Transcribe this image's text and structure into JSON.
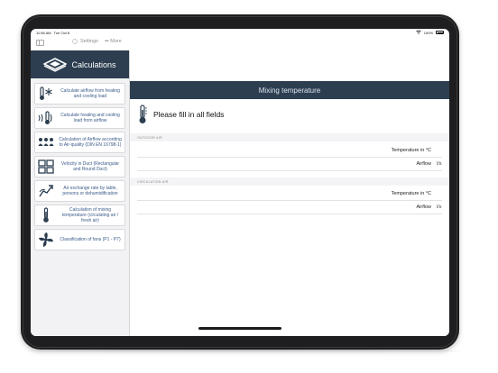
{
  "status_bar": {
    "time": "11:56 AM",
    "date": "Tue Oct 8",
    "battery": "100%"
  },
  "topbar": {
    "settings_label": "Settings",
    "more_label": "More"
  },
  "sidebar": {
    "title": "Calculations",
    "items": [
      {
        "label": "Calculate airflow from heating and cooling load",
        "icon": "thermometer-snowflake-icon"
      },
      {
        "label": "Calculate heating and cooling load from airflow",
        "icon": "airflow-thermometer-icon"
      },
      {
        "label": "Calculation of Airflow according to Air-quality (DIN EN 16798-1)",
        "icon": "people-group-icon"
      },
      {
        "label": "Velocity in Duct (Rectangular and Round Duct)",
        "icon": "duct-grid-icon"
      },
      {
        "label": "Air exchange rate by table, persons or dehumidification",
        "icon": "air-exchange-icon"
      },
      {
        "label": "Calculation of mixing temperature (circulating air / fresh air)",
        "icon": "mixing-thermometer-icon"
      },
      {
        "label": "Classification of fans (P1 - P7)",
        "icon": "fan-icon"
      }
    ]
  },
  "main": {
    "title": "Mixing temperature",
    "instruction": "Please fill in all fields",
    "sections": [
      {
        "label": "OUTDOOR AIR",
        "fields": [
          {
            "label": "Temperature in °C",
            "unit": ""
          },
          {
            "label": "Airflow",
            "unit": "l/s"
          }
        ]
      },
      {
        "label": "CIRCULATION AIR",
        "fields": [
          {
            "label": "Temperature in °C",
            "unit": ""
          },
          {
            "label": "Airflow",
            "unit": "l/s"
          }
        ]
      }
    ]
  },
  "colors": {
    "header_bg": "#2c3e50",
    "sidebar_bg": "#f2f2f4",
    "link_text": "#3a5a8a"
  }
}
